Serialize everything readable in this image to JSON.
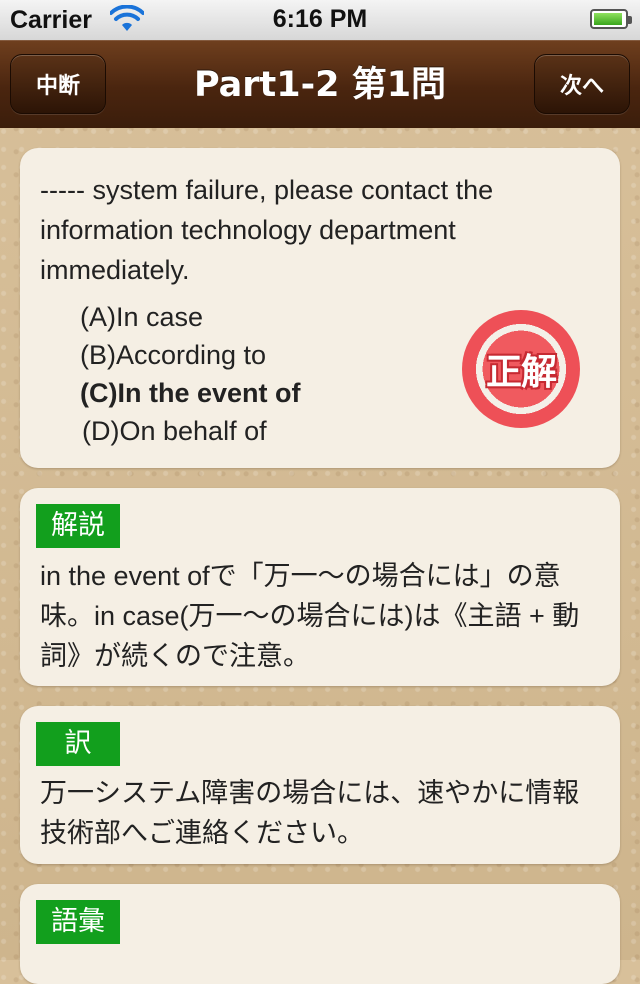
{
  "status_bar": {
    "carrier": "Carrier",
    "time": "6:16 PM",
    "battery_level": 0.95
  },
  "nav": {
    "title": "Part1-2 第1問",
    "left_button": "中断",
    "right_button": "次へ"
  },
  "question": {
    "text": "----- system failure, please contact the information technology department immediately.",
    "choices": [
      {
        "label": "(A)In case",
        "correct": false
      },
      {
        "label": "(B)According to",
        "correct": false
      },
      {
        "label": "(C)In the event of",
        "correct": true
      },
      {
        "label": "(D)On behalf of",
        "correct": false
      }
    ],
    "result_badge": "正解",
    "result_badge_color": "#ef545a"
  },
  "explanation": {
    "tag": "解説",
    "text": "in the event ofで「万一〜の場合には」の意味。in case(万一〜の場合には)は《主語 + 動詞》が続くので注意。"
  },
  "translation": {
    "tag": "訳",
    "text": "万一システム障害の場合には、速やかに情報技術部へご連絡ください。"
  },
  "vocabulary": {
    "tag": "語彙"
  },
  "colors": {
    "nav_bar": "#4a250f",
    "tag_green": "#129f1d",
    "card_bg": "#f5efe4"
  }
}
